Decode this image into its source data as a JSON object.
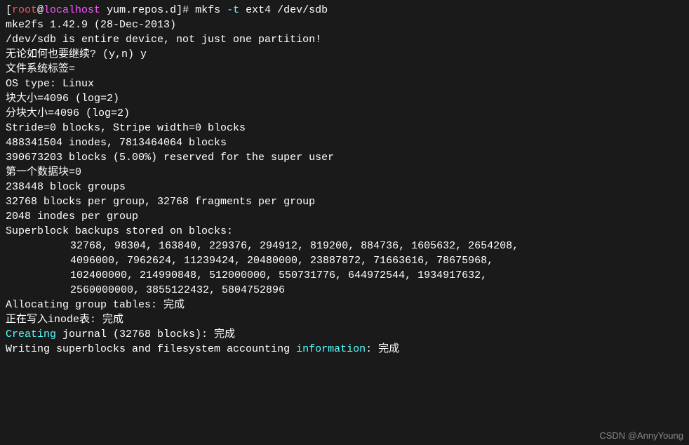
{
  "prompt": {
    "bracket_open": "[",
    "user": "root",
    "at": "@",
    "host": "localhost",
    "space": " ",
    "dir": "yum.repos.d",
    "bracket_close": "]# ",
    "cmd_start": "mkfs ",
    "cmd_opt": "-t",
    "cmd_args": " ext4 /dev/sdb"
  },
  "lines": {
    "l1": "mke2fs 1.42.9 (28-Dec-2013)",
    "l2": "/dev/sdb is entire device, not just one partition!",
    "l3": "无论如何也要继续? (y,n) y",
    "l4": "文件系统标签=",
    "l5": "OS type: Linux",
    "l6": "块大小=4096 (log=2)",
    "l7": "分块大小=4096 (log=2)",
    "l8": "Stride=0 blocks, Stripe width=0 blocks",
    "l9": "488341504 inodes, 7813464064 blocks",
    "l10": "390673203 blocks (5.00%) reserved for the super user",
    "l11": "第一个数据块=0",
    "l12": "238448 block groups",
    "l13": "32768 blocks per group, 32768 fragments per group",
    "l14": "2048 inodes per group",
    "l15": "Superblock backups stored on blocks: ",
    "sb1": "32768, 98304, 163840, 229376, 294912, 819200, 884736, 1605632, 2654208, ",
    "sb2": "4096000, 7962624, 11239424, 20480000, 23887872, 71663616, 78675968, ",
    "sb3": "102400000, 214990848, 512000000, 550731776, 644972544, 1934917632, ",
    "sb4": "2560000000, 3855122432, 5804752896",
    "blank": "",
    "l16": "Allocating group tables: 完成                            ",
    "l17": "正在写入inode表: 完成                            ",
    "l18a": "Creating",
    "l18b": " journal (32768 blocks): 完成",
    "l19a": "Writing superblocks and filesystem accounting ",
    "l19b": "information",
    "l19c": ": 完成"
  },
  "watermark": "CSDN @AnnyYoung"
}
